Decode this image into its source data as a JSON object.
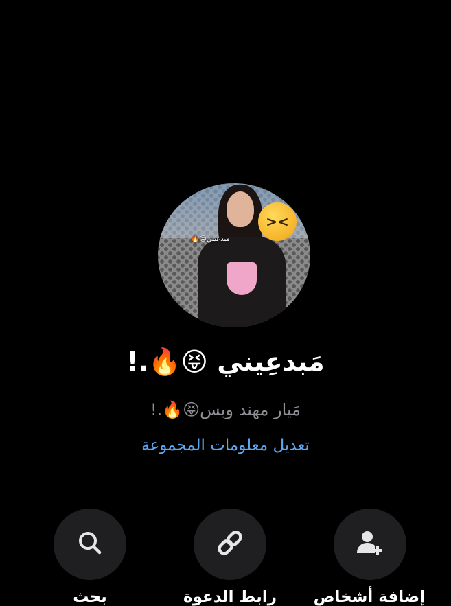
{
  "group": {
    "title": "مَبدعِيني 😝🔥.!",
    "subtitle": "مَيار مهند وبس😝🔥.!",
    "edit_label": "تعديل معلومات المجموعة",
    "avatar_overlay_text": "مبدعيني😝🔥"
  },
  "actions": [
    {
      "label": "بحث",
      "icon": "search-icon"
    },
    {
      "label": "رابط الدعوة",
      "icon": "link-icon"
    },
    {
      "label": "إضافة أشخاص",
      "icon": "add-person-icon"
    }
  ],
  "colors": {
    "background": "#000000",
    "link": "#5ea6f0",
    "subtitle": "#8e8e93",
    "button_bg": "#1f1f21"
  }
}
